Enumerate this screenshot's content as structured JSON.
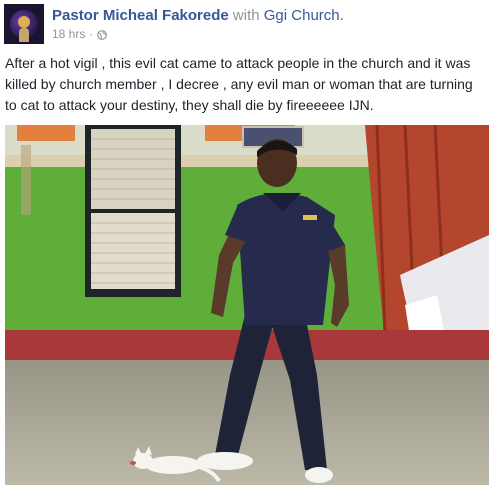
{
  "post": {
    "author": "Pastor Micheal Fakorede",
    "with_text": "with",
    "group": "Ggi Church.",
    "timestamp": "18 hrs",
    "separator": "·",
    "privacy_icon": "globe-icon",
    "caption": "After a hot vigil , this evil cat came to attack people in the church and it was killed by church member , I decree , any evil man or woman that are turning to cat to attack your destiny, they shall die by fireeeeee IJN.",
    "photo": {
      "description_icon": "photo"
    }
  },
  "colors": {
    "link": "#365899",
    "secondary_text": "#90949c",
    "body_text": "#1d2129"
  }
}
